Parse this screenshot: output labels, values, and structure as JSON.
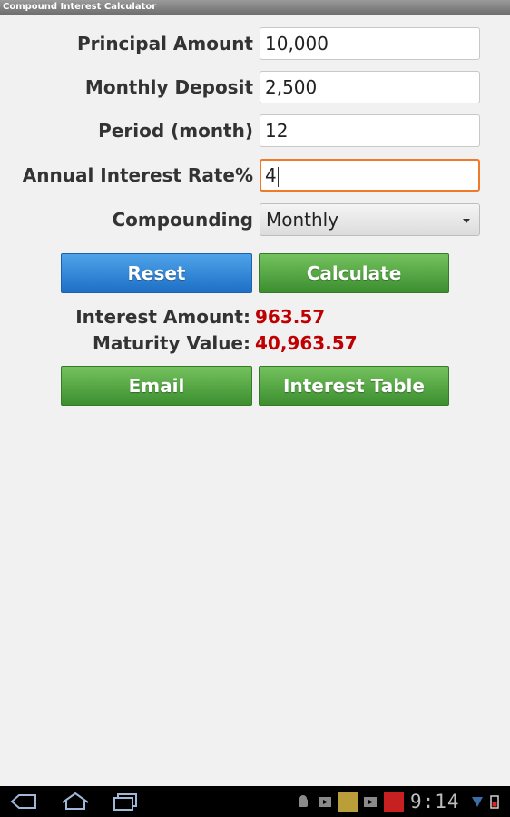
{
  "window": {
    "title": "Compound Interest Calculator"
  },
  "form": {
    "principal": {
      "label": "Principal Amount",
      "value": "10,000"
    },
    "deposit": {
      "label": "Monthly Deposit",
      "value": "2,500"
    },
    "period": {
      "label": "Period (month)",
      "value": "12"
    },
    "rate": {
      "label": "Annual Interest Rate%",
      "value": "4"
    },
    "compounding": {
      "label": "Compounding",
      "value": "Monthly"
    }
  },
  "buttons": {
    "reset": "Reset",
    "calculate": "Calculate",
    "email": "Email",
    "interest_table": "Interest Table"
  },
  "results": {
    "interest_label": "Interest Amount:",
    "interest_value": "963.57",
    "maturity_label": "Maturity Value:",
    "maturity_value": "40,963.57"
  },
  "system_bar": {
    "time": "9:14",
    "icons": [
      "back-icon",
      "home-icon",
      "recent-apps-icon",
      "android-debug-icon",
      "media-icon",
      "app-thumbnail-icon",
      "media-icon",
      "app-notification-icon",
      "wifi-icon",
      "battery-icon"
    ]
  },
  "colors": {
    "result_value": "#c00000",
    "reset_button": "#2a7fd4",
    "green_button": "#4fa33d",
    "focus_border": "#f07a28"
  }
}
